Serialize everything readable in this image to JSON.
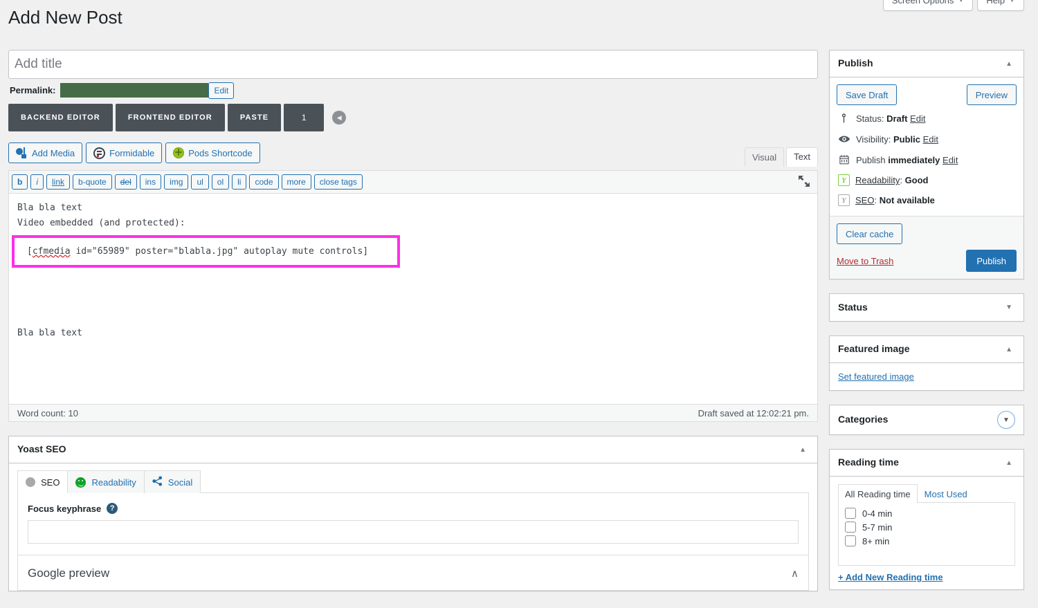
{
  "screen_meta": {
    "screen_options_label": "Screen Options",
    "help_label": "Help",
    "caret": "▼"
  },
  "page": {
    "title": "Add New Post"
  },
  "title_field": {
    "placeholder": "Add title",
    "value": ""
  },
  "permalink": {
    "label": "Permalink:",
    "edit_label": "Edit",
    "masked_color": "#456b47"
  },
  "wpbakery": {
    "backend_editor": "BACKEND EDITOR",
    "frontend_editor": "FRONTEND EDITOR",
    "paste": "PASTE",
    "count": "1",
    "collapse_icon": "◀"
  },
  "media_buttons": [
    {
      "label": "Add Media",
      "icon": "add-media-icon"
    },
    {
      "label": "Formidable",
      "icon": "formidable-icon"
    },
    {
      "label": "Pods Shortcode",
      "icon": "pods-icon"
    }
  ],
  "editor_tabs": [
    {
      "label": "Visual",
      "active": false
    },
    {
      "label": "Text",
      "active": true
    }
  ],
  "quicktags": [
    "b",
    "i",
    "link",
    "b-quote",
    "del",
    "ins",
    "img",
    "ul",
    "ol",
    "li",
    "code",
    "more",
    "close tags"
  ],
  "content": {
    "line1": "Bla bla text",
    "line2": "Video embedded (and protected):",
    "highlighted_shortcode_prefix": "cfmedia",
    "highlighted_shortcode_rest": " id=\"65989\" poster=\"blabla.jpg\" autoplay mute controls]",
    "highlight_color": "#ff2fe6",
    "line4": "Bla bla text"
  },
  "status_bar": {
    "word_count_label": "Word count: 10",
    "draft_saved": "Draft saved at 12:02:21 pm."
  },
  "yoast_metabox": {
    "title": "Yoast SEO",
    "collapse_icon": "▲",
    "tabs": [
      {
        "label": "SEO",
        "icon": "seo-score-dot-icon",
        "active": true
      },
      {
        "label": "Readability",
        "icon": "readability-smiley-icon",
        "active": false
      },
      {
        "label": "Social",
        "icon": "share-icon",
        "active": false
      }
    ],
    "focus_keyphrase_label": "Focus keyphrase",
    "focus_keyphrase_value": "",
    "help_icon": "?",
    "google_preview_label": "Google preview",
    "google_preview_chevron": "∧"
  },
  "publish_box": {
    "title": "Publish",
    "collapse_icon": "▲",
    "save_draft_label": "Save Draft",
    "preview_label": "Preview",
    "rows": [
      {
        "icon": "pin-icon",
        "prefix": "Status: ",
        "value": "Draft",
        "suffix": "",
        "edit": "Edit",
        "link": false
      },
      {
        "icon": "eye-icon",
        "prefix": "Visibility: ",
        "value": "Public",
        "suffix": "",
        "edit": "Edit",
        "link": false
      },
      {
        "icon": "calendar-icon",
        "prefix": "Publish ",
        "value": "immediately",
        "suffix": "",
        "edit": "Edit",
        "link": false
      },
      {
        "icon": "yoast-green-icon",
        "prefix": "Readability",
        "value": "Good",
        "suffix": "",
        "edit": "",
        "link": true
      },
      {
        "icon": "yoast-gray-icon",
        "prefix": "SEO",
        "value": "Not available",
        "suffix": "",
        "edit": "",
        "link": true
      }
    ],
    "clear_cache_label": "Clear cache",
    "trash_label": "Move to Trash",
    "publish_label": "Publish"
  },
  "status_box": {
    "title": "Status",
    "collapse_icon": "▼"
  },
  "featured_image_box": {
    "title": "Featured image",
    "collapse_icon": "▲",
    "set_link": "Set featured image"
  },
  "categories_box": {
    "title": "Categories",
    "collapse_icon": "▼"
  },
  "reading_time_box": {
    "title": "Reading time",
    "collapse_icon": "▲",
    "tabs": [
      {
        "label": "All Reading time",
        "active": true
      },
      {
        "label": "Most Used",
        "active": false
      }
    ],
    "options": [
      {
        "label": "0-4 min",
        "checked": false
      },
      {
        "label": "5-7 min",
        "checked": false
      },
      {
        "label": "8+ min",
        "checked": false
      }
    ],
    "add_new_label": "+ Add New Reading time"
  }
}
